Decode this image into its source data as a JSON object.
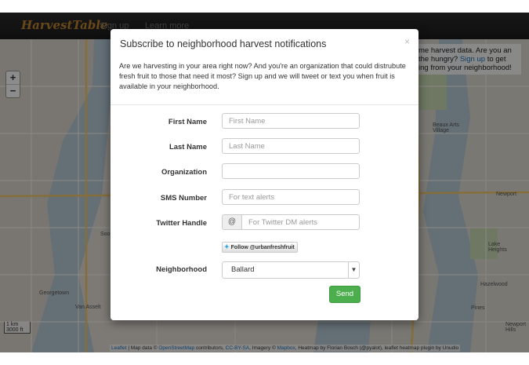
{
  "navbar": {
    "brand": "HarvestTable",
    "links": [
      "Sign up",
      "Learn more"
    ]
  },
  "map": {
    "zoom_in": "+",
    "zoom_out": "−",
    "info_text_before": "me harvest data. Are you an",
    "info_text_mid": "the hungry? ",
    "info_link": "Sign up",
    "info_text_after": " to get",
    "info_text_end": "ing from your neighborhood!",
    "scale_km": "1 km",
    "scale_ft": "3000 ft",
    "places": [
      "Beaux Arts Village",
      "Newport",
      "Lake Heights",
      "Hazelwood",
      "Pines",
      "Newport Hills",
      "Georgetown",
      "Van Asselt",
      "Soo"
    ],
    "attribution": {
      "leaflet": "Leaflet",
      "t1": " | Map data © ",
      "osm": "OpenStreetMap",
      "t2": " contributors, ",
      "ccbysa": "CC-BY-SA",
      "t3": ", Imagery © ",
      "mapbox": "Mapbox",
      "t4": ", Heatmap by Florian Bosch (@pyalot), leaflet heatmap plugin by Unudio"
    }
  },
  "modal": {
    "title": "Subscribe to neighborhood harvest notifications",
    "close": "×",
    "description": "Are we harvesting in your area right now? And you're an organization that could distrubute fresh fruit to those that need it most? Sign up and we will tweet or text you when fruit is available in your neighborhood.",
    "fields": {
      "first_name": {
        "label": "First Name",
        "placeholder": "First Name"
      },
      "last_name": {
        "label": "Last Name",
        "placeholder": "Last Name"
      },
      "organization": {
        "label": "Organization",
        "placeholder": ""
      },
      "sms": {
        "label": "SMS Number",
        "placeholder": "For text alerts"
      },
      "twitter": {
        "label": "Twitter Handle",
        "addon": "@",
        "placeholder": "For Twitter DM alerts"
      },
      "neighborhood": {
        "label": "Neighborhood",
        "value": "Ballard"
      }
    },
    "follow_button": "Follow @urbanfreshfruit",
    "send_button": "Send"
  },
  "colors": {
    "brand": "#c0852f",
    "send": "#4cae4c",
    "link": "#1f6fbf",
    "twitter": "#2ea7e0"
  }
}
